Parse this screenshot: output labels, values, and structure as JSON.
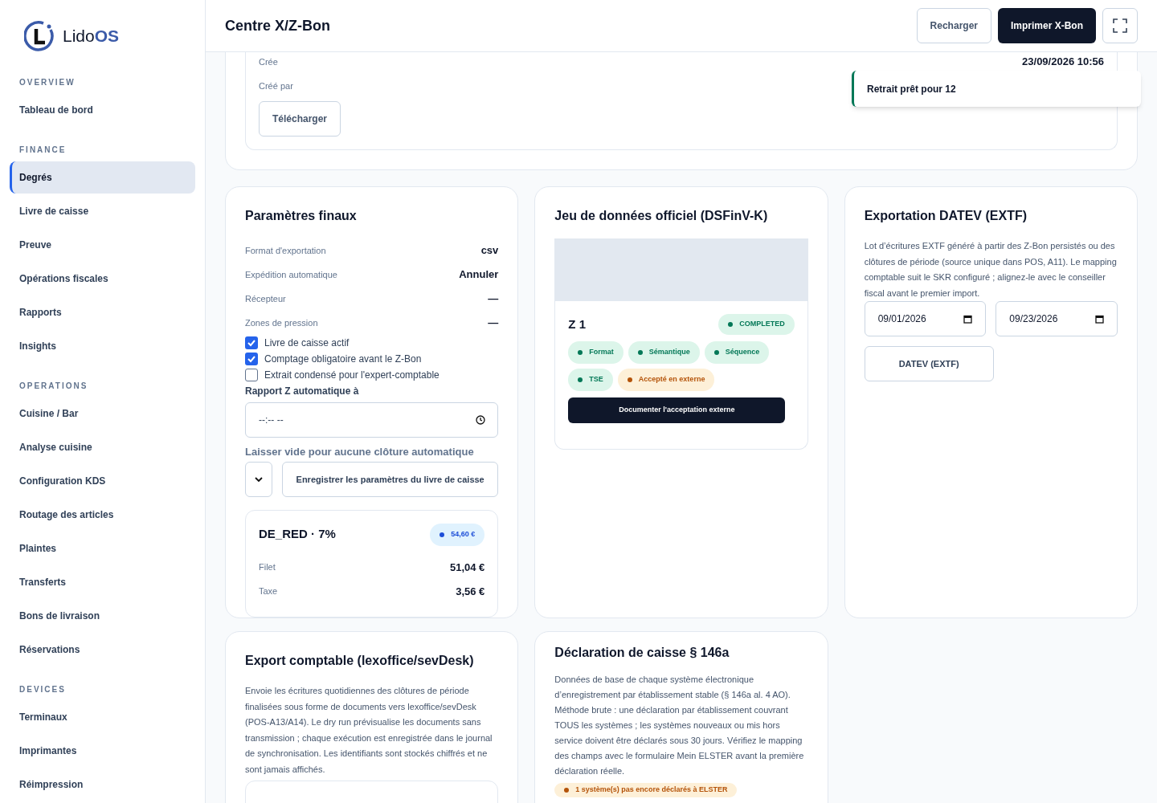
{
  "sidebar": {
    "logo": {
      "text_a": "Lido",
      "text_b": "OS"
    },
    "sections": [
      {
        "title": "OVERVIEW",
        "items": [
          {
            "label": "Tableau de bord",
            "selected": false
          }
        ]
      },
      {
        "title": "FINANCE",
        "items": [
          {
            "label": "Degrés",
            "selected": true
          },
          {
            "label": "Livre de caisse",
            "selected": false
          },
          {
            "label": "Preuve",
            "selected": false
          },
          {
            "label": "Opérations fiscales",
            "selected": false
          },
          {
            "label": "Rapports",
            "selected": false
          },
          {
            "label": "Insights",
            "selected": false
          }
        ]
      },
      {
        "title": "OPERATIONS",
        "items": [
          {
            "label": "Cuisine / Bar",
            "selected": false
          },
          {
            "label": "Analyse cuisine",
            "selected": false
          },
          {
            "label": "Configuration KDS",
            "selected": false
          },
          {
            "label": "Routage des articles",
            "selected": false
          },
          {
            "label": "Plaintes",
            "selected": false
          },
          {
            "label": "Transferts",
            "selected": false
          },
          {
            "label": "Bons de livraison",
            "selected": false
          },
          {
            "label": "Réservations",
            "selected": false
          }
        ]
      },
      {
        "title": "DEVICES",
        "items": [
          {
            "label": "Terminaux",
            "selected": false
          },
          {
            "label": "Imprimantes",
            "selected": false
          },
          {
            "label": "Réimpression",
            "selected": false
          }
        ]
      }
    ]
  },
  "header": {
    "title": "Centre X/Z-Bon",
    "buttons": [
      {
        "label": "Recharger",
        "kind": "outline"
      },
      {
        "label": "Imprimer X-Bon",
        "kind": "primary"
      },
      {
        "kind": "fullscreen"
      }
    ]
  },
  "record_card": {
    "fields": [
      {
        "label": "Crée",
        "value": "23/09/2026 10:56"
      },
      {
        "label": "Créé par"
      }
    ],
    "download_button": "Télécharger"
  },
  "toast": {
    "text": "Retrait prêt pour 12"
  },
  "settings_card": {
    "title": "Paramètres finaux",
    "rows": [
      {
        "label": "Format d'exportation",
        "value": "csv"
      },
      {
        "label": "Expédition automatique",
        "value": "Annuler"
      },
      {
        "label": "Récepteur",
        "value": "—"
      },
      {
        "label": "Zones de pression",
        "value": "—"
      }
    ],
    "checkboxes": [
      {
        "label": "Livre de caisse actif",
        "checked": true
      },
      {
        "label": "Comptage obligatoire avant le Z-Bon",
        "checked": true
      },
      {
        "label": "Extrait condensé pour l'expert-comptable",
        "checked": false
      }
    ],
    "time_label": "Rapport Z automatique à",
    "time_placeholder": "--:-- --",
    "hint": "Laisser vide pour aucune clôture automatique",
    "save_button": "Enregistrer les paramètres du livre de caisse",
    "tax_card": {
      "title": "DE_RED · 7%",
      "badge": "54,60 €",
      "rows": [
        {
          "label": "Filet",
          "value": "51,04 €"
        },
        {
          "label": "Taxe",
          "value": "3,56 €"
        }
      ]
    }
  },
  "dataset_card": {
    "title": "Jeu de données officiel (DSFinV-K)",
    "z_card": {
      "title": "Z 1",
      "status": "COMPLETED",
      "chips": [
        {
          "label": "Format",
          "color": "#047857"
        },
        {
          "label": "Sémantique",
          "color": "#047857"
        },
        {
          "label": "Séquence",
          "color": "#047857"
        },
        {
          "label": "TSE",
          "color": "#047857"
        },
        {
          "label": "Accepté en externe",
          "color": "#b45309"
        }
      ],
      "button": "Documenter l'acceptation externe"
    }
  },
  "datev_card": {
    "title": "Exportation DATEV (EXTF)",
    "description": "Lot d’écritures EXTF généré à partir des Z-Bon persistés ou des clôtures de période (source unique dans POS, A11). Le mapping comptable suit le SKR configuré ; alignez-le avec le conseiller fiscal avant le premier import.",
    "dates": [
      "09/01/2026",
      "09/23/2026"
    ],
    "button": "DATEV (EXTF)"
  },
  "export_card": {
    "title": "Export comptable (lexoffice/sevDesk)",
    "description": "Envoie les écritures quotidiennes des clôtures de période finalisées sous forme de documents vers lexoffice/sevDesk (POS-A13/A14). Le dry run prévisualise les documents sans transmission ; chaque exécution est enregistrée dans le journal de synchronisation. Les identifiants sont stockés chiffrés et ne sont jamais affichés."
  },
  "declaration_card": {
    "title": "Déclaration de caisse § 146a",
    "description": "Données de base de chaque système électronique d’enregistrement par établissement stable (§ 146a al. 4 AO). Méthode brute : une déclaration par établissement couvrant TOUS les systèmes ; les systèmes nouveaux ou mis hors service doivent être déclarés sous 30 jours. Vérifiez le mapping des champs avec le formulaire Mein ELSTER avant la première déclaration réelle.",
    "badge": "1 système(s) pas encore déclarés à ELSTER"
  }
}
